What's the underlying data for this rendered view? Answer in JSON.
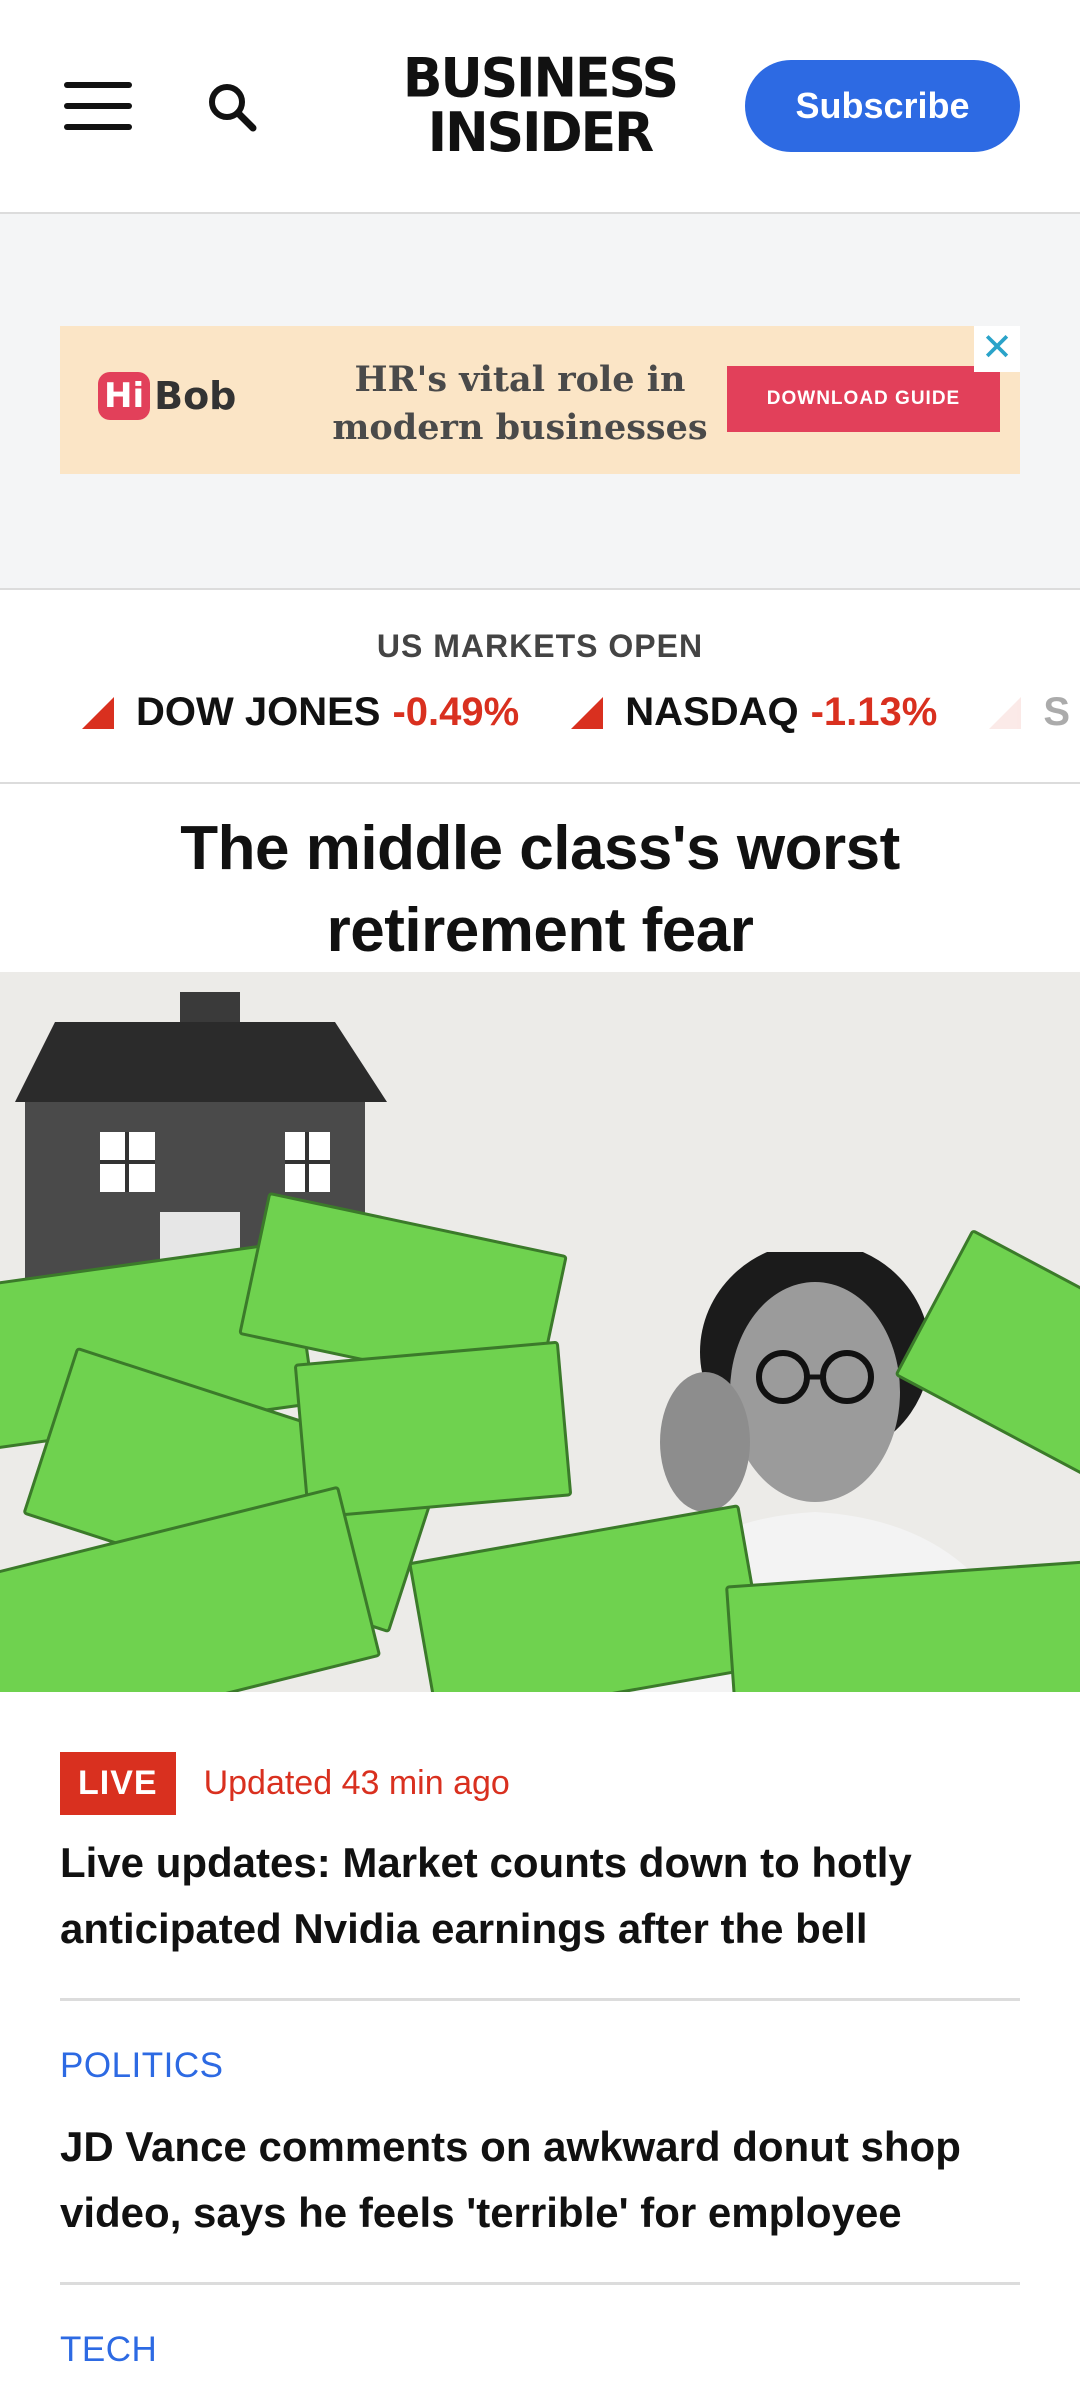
{
  "header": {
    "logo_line1": "BUSINESS",
    "logo_line2": "INSIDER",
    "subscribe_label": "Subscribe",
    "menu_icon": "hamburger-menu-icon",
    "search_icon": "search-icon",
    "accent_color": "#2d6ae3"
  },
  "ad": {
    "brand_hi": "Hi",
    "brand_rest": "Bob",
    "text_line1": "HR's vital role in",
    "text_line2": "modern businesses",
    "cta": "DOWNLOAD GUIDE",
    "close": "✕"
  },
  "markets": {
    "title": "US MARKETS OPEN",
    "tickers": [
      {
        "name": "DOW JONES",
        "change": "-0.49%"
      },
      {
        "name": "NASDAQ",
        "change": "-1.13%"
      },
      {
        "name": "S",
        "change": ""
      }
    ],
    "down_color": "#d9301f"
  },
  "lead": {
    "headline": "The middle class's worst retirement fear"
  },
  "stories": [
    {
      "badge": "LIVE",
      "updated": "Updated 43 min ago",
      "title": "Live updates: Market counts down to hotly anticipated Nvidia earnings after the bell"
    },
    {
      "kicker": "POLITICS",
      "title": "JD Vance comments on awkward donut shop video, says he feels 'terrible' for employee"
    },
    {
      "kicker": "TECH"
    }
  ]
}
